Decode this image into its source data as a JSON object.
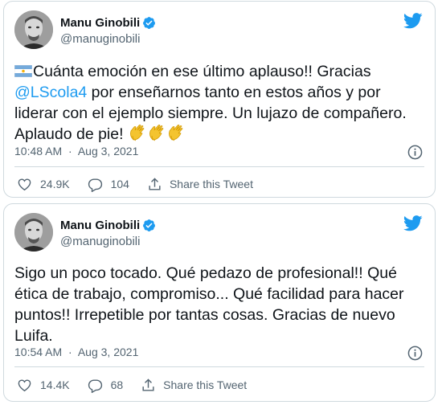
{
  "tweets": [
    {
      "author": {
        "name": "Manu Ginobili",
        "handle": "@manuginobili"
      },
      "text_part1": "Cuánta emoción en ese último aplauso!! Gracias ",
      "mention": "@LScola4",
      "text_part2": " por enseñarnos tanto en estos años y por liderar con el ejemplo siempre. Un lujazo de compañero. Aplaudo de pie! ",
      "leading_emoji": "argentina-flag-icon",
      "trailing_emoji": "clapping-hands-icon",
      "trailing_emoji_count": 3,
      "time": "10:48 AM",
      "separator": "·",
      "date": "Aug 3, 2021",
      "likes": "24.9K",
      "replies": "104",
      "share_label": "Share this Tweet"
    },
    {
      "author": {
        "name": "Manu Ginobili",
        "handle": "@manuginobili"
      },
      "text": "Sigo un poco tocado. Qué pedazo de profesional!! Qué ética de trabajo, compromiso... Qué facilidad para hacer puntos!! Irrepetible por tantas cosas. Gracias de nuevo Luifa.",
      "time": "10:54 AM",
      "separator": "·",
      "date": "Aug 3, 2021",
      "likes": "14.4K",
      "replies": "68",
      "share_label": "Share this Tweet"
    }
  ],
  "colors": {
    "accent": "#1d9bf0",
    "text": "#0f1419",
    "secondary": "#536471",
    "border": "#cfd9de"
  },
  "icons": [
    "verified-badge-icon",
    "twitter-bird-icon",
    "info-icon",
    "heart-icon",
    "reply-icon",
    "share-icon"
  ]
}
